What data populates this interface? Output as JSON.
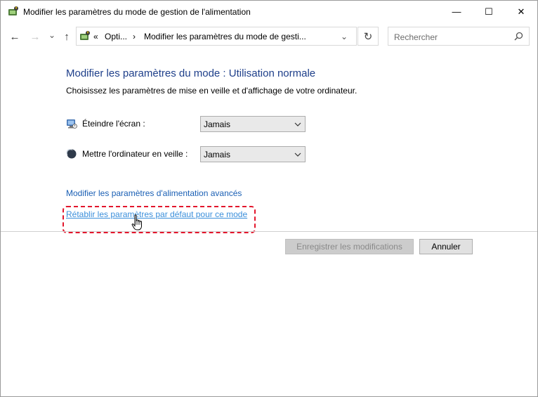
{
  "window": {
    "title": "Modifier les paramètres du mode de gestion de l'alimentation",
    "minimize_glyph": "—",
    "maximize_glyph": "☐",
    "close_glyph": "✕"
  },
  "nav": {
    "back_glyph": "←",
    "forward_glyph": "→",
    "history_glyph": "⌄",
    "up_glyph": "↑",
    "refresh_glyph": "↻"
  },
  "address": {
    "overflow": "«",
    "crumbs": [
      "Opti...",
      "Modifier les paramètres du mode de gesti..."
    ],
    "separator": "›",
    "dropdown_glyph": "⌄"
  },
  "search": {
    "placeholder": "Rechercher"
  },
  "main": {
    "title": "Modifier les paramètres du mode : Utilisation normale",
    "subtitle": "Choisissez les paramètres de mise en veille et d'affichage de votre ordinateur.",
    "settings": [
      {
        "label": "Éteindre l'écran :",
        "value": "Jamais",
        "icon": "monitor-icon"
      },
      {
        "label": "Mettre l'ordinateur en veille :",
        "value": "Jamais",
        "icon": "sleep-moon-icon"
      }
    ],
    "advanced_link": "Modifier les paramètres d'alimentation avancés",
    "restore_link": "Rétablir les paramètres par défaut pour ce mode"
  },
  "buttons": {
    "save": "Enregistrer les modifications",
    "cancel": "Annuler"
  },
  "colors": {
    "title_blue": "#1e3f8a",
    "link_blue": "#1a5fb4",
    "highlight_red": "#e3162c"
  }
}
